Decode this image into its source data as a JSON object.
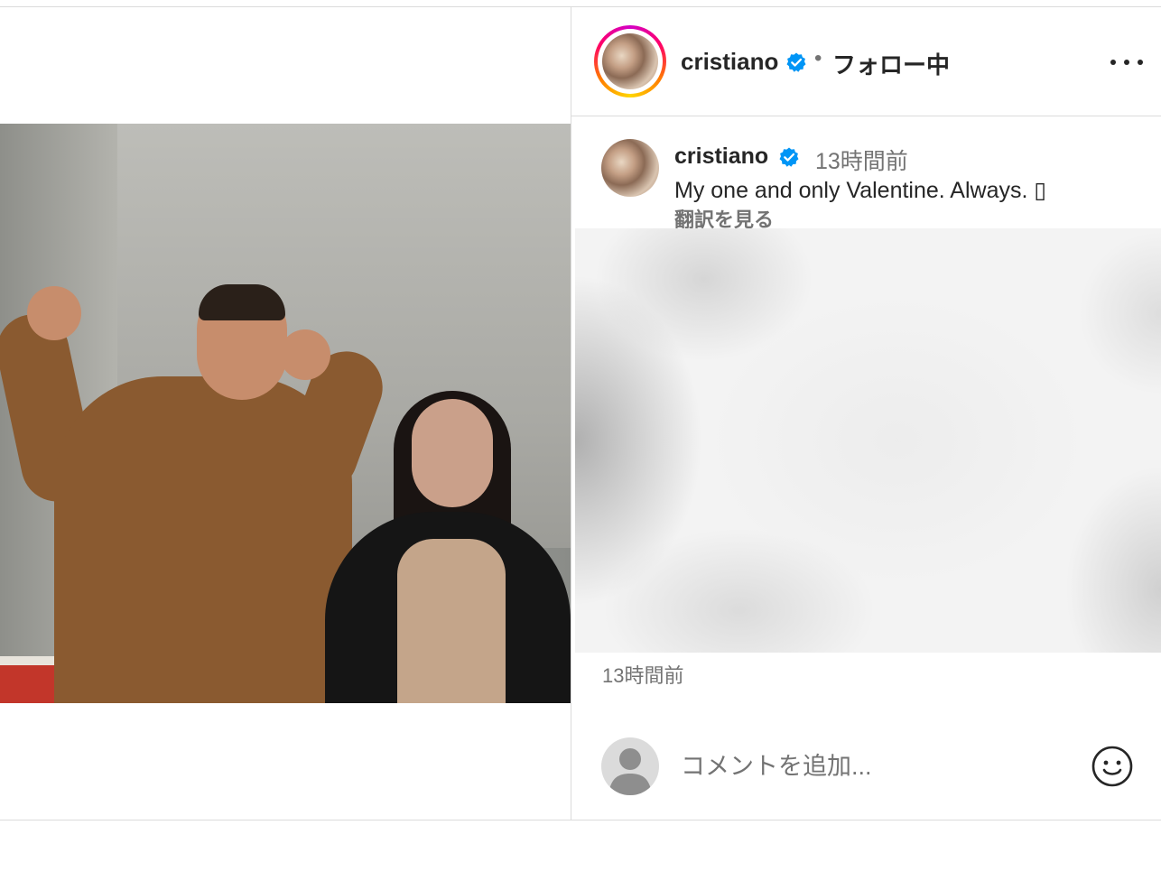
{
  "header": {
    "username": "cristiano",
    "separator": "•",
    "follow_label": "フォロー中"
  },
  "caption": {
    "username": "cristiano",
    "time": "13時間前",
    "text": "My one and only Valentine. Always. ▯",
    "translate_label": "翻訳を見る"
  },
  "post": {
    "time": "13時間前"
  },
  "comment": {
    "placeholder": "コメントを追加..."
  },
  "icons": {
    "verified": "verified-badge-icon",
    "more": "more-options-icon",
    "tag": "user-tag-icon",
    "emoji": "emoji-icon",
    "default_avatar": "default-avatar-icon"
  },
  "colors": {
    "verified": "#0095f6",
    "text_primary": "#262626",
    "text_secondary": "#737373",
    "border": "#dbdbdb"
  }
}
